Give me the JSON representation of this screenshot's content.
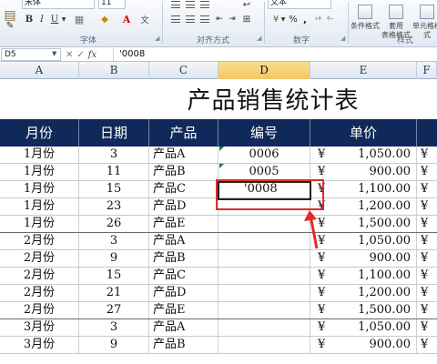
{
  "ribbon": {
    "font_name": "宋体",
    "font_size": "11",
    "format_buttons": [
      "B",
      "I",
      "U"
    ],
    "number_format": "文本",
    "number_symbols": [
      "%",
      ","
    ],
    "groups": {
      "font": "字体",
      "alignment": "对齐方式",
      "number": "数字",
      "styles": "样式"
    },
    "style_buttons": [
      "条件格式",
      "套用\n表格格式",
      "单元格样式"
    ]
  },
  "formula_bar": {
    "name_box": "D5",
    "fx": "fx",
    "content": "'0008"
  },
  "columns": [
    "A",
    "B",
    "C",
    "D",
    "E",
    "F"
  ],
  "selected_column": "D",
  "table": {
    "title": "产品销售统计表",
    "headers": [
      "月份",
      "日期",
      "产品",
      "编号",
      "单价",
      ""
    ],
    "rows": [
      {
        "month": "1月份",
        "day": "3",
        "product": "产品A",
        "code": "0006",
        "yen": "¥",
        "price": "1,050.00",
        "extra": "¥"
      },
      {
        "month": "1月份",
        "day": "11",
        "product": "产品B",
        "code": "0005",
        "yen": "¥",
        "price": "900.00",
        "extra": "¥"
      },
      {
        "month": "1月份",
        "day": "15",
        "product": "产品C",
        "code": "'0008",
        "yen": "¥",
        "price": "1,100.00",
        "extra": "¥"
      },
      {
        "month": "1月份",
        "day": "23",
        "product": "产品D",
        "code": "",
        "yen": "¥",
        "price": "1,200.00",
        "extra": "¥"
      },
      {
        "month": "1月份",
        "day": "26",
        "product": "产品E",
        "code": "",
        "yen": "¥",
        "price": "1,500.00",
        "extra": "¥"
      },
      {
        "month": "2月份",
        "day": "3",
        "product": "产品A",
        "code": "",
        "yen": "¥",
        "price": "1,050.00",
        "extra": "¥"
      },
      {
        "month": "2月份",
        "day": "9",
        "product": "产品B",
        "code": "",
        "yen": "¥",
        "price": "900.00",
        "extra": "¥"
      },
      {
        "month": "2月份",
        "day": "15",
        "product": "产品C",
        "code": "",
        "yen": "¥",
        "price": "1,100.00",
        "extra": "¥"
      },
      {
        "month": "2月份",
        "day": "21",
        "product": "产品D",
        "code": "",
        "yen": "¥",
        "price": "1,200.00",
        "extra": "¥"
      },
      {
        "month": "2月份",
        "day": "27",
        "product": "产品E",
        "code": "",
        "yen": "¥",
        "price": "1,500.00",
        "extra": "¥"
      },
      {
        "month": "3月份",
        "day": "3",
        "product": "产品A",
        "code": "",
        "yen": "¥",
        "price": "1,050.00",
        "extra": "¥"
      },
      {
        "month": "3月份",
        "day": "9",
        "product": "产品B",
        "code": "",
        "yen": "¥",
        "price": "900.00",
        "extra": "¥"
      }
    ]
  },
  "colors": {
    "header_bg": "#10295a",
    "annotation": "#e02c2c",
    "ribbon_bg": "#e3e9f2"
  }
}
